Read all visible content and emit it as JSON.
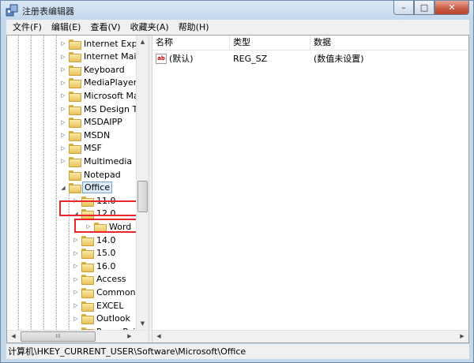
{
  "window": {
    "title": "注册表编辑器",
    "buttons": {
      "minimize": "–",
      "maximize": "□",
      "close": "✕"
    }
  },
  "menubar": {
    "items": [
      "文件(F)",
      "编辑(E)",
      "查看(V)",
      "收藏夹(A)",
      "帮助(H)"
    ]
  },
  "tree": {
    "items": [
      {
        "label": "Internet Explor",
        "expander": "▷",
        "selected": false
      },
      {
        "label": "Internet Mail a",
        "expander": "▷",
        "selected": false
      },
      {
        "label": "Keyboard",
        "expander": "▷",
        "selected": false
      },
      {
        "label": "MediaPlayer",
        "expander": "▷",
        "selected": false
      },
      {
        "label": "Microsoft Mar",
        "expander": "▷",
        "selected": false
      },
      {
        "label": "MS Design Too",
        "expander": "▷",
        "selected": false
      },
      {
        "label": "MSDAIPP",
        "expander": "▷",
        "selected": false
      },
      {
        "label": "MSDN",
        "expander": "▷",
        "selected": false
      },
      {
        "label": "MSF",
        "expander": "▷",
        "selected": false
      },
      {
        "label": "Multimedia",
        "expander": "▷",
        "selected": false
      },
      {
        "label": "Notepad",
        "expander": "",
        "selected": false
      },
      {
        "label": "Office",
        "expander": "◢",
        "selected": true
      },
      {
        "label": "11.0",
        "expander": "▷",
        "selected": false
      },
      {
        "label": "12.0",
        "expander": "◢",
        "selected": false,
        "highlighted": true
      },
      {
        "label": "Word",
        "expander": "▷",
        "selected": false,
        "highlighted": true
      },
      {
        "label": "14.0",
        "expander": "▷",
        "selected": false
      },
      {
        "label": "15.0",
        "expander": "▷",
        "selected": false
      },
      {
        "label": "16.0",
        "expander": "▷",
        "selected": false
      },
      {
        "label": "Access",
        "expander": "▷",
        "selected": false
      },
      {
        "label": "Common",
        "expander": "▷",
        "selected": false
      },
      {
        "label": "EXCEL",
        "expander": "▷",
        "selected": false
      },
      {
        "label": "Outlook",
        "expander": "▷",
        "selected": false
      },
      {
        "label": "PowerPoint",
        "expander": "▷",
        "selected": false
      }
    ],
    "scroll_up": "▲",
    "scroll_down": "▼",
    "scroll_left": "◀",
    "scroll_right": "▶",
    "thumb_grip": "III"
  },
  "list": {
    "columns": [
      "名称",
      "类型",
      "数据"
    ],
    "rows": [
      {
        "icon": "ab",
        "name": "(默认)",
        "type": "REG_SZ",
        "data": "(数值未设置)"
      }
    ],
    "scroll_left": "◀",
    "scroll_right": "▶"
  },
  "statusbar": {
    "path": "计算机\\HKEY_CURRENT_USER\\Software\\Microsoft\\Office"
  },
  "colors": {
    "highlight_box": "#e8262c",
    "selection": "#dcebfc"
  }
}
